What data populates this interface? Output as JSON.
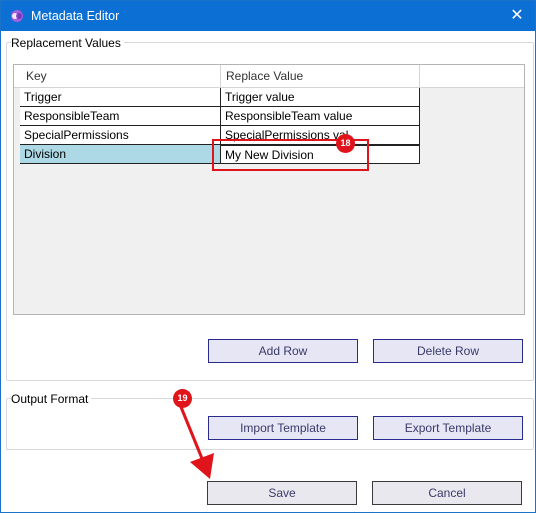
{
  "window": {
    "title": "Metadata Editor",
    "close_glyph": "✕",
    "accent_color": "#0b6fd4"
  },
  "replacement_values": {
    "group_label": "Replacement Values",
    "columns": [
      "Key",
      "Replace Value"
    ],
    "rows": [
      {
        "key": "Trigger",
        "value": "Trigger value"
      },
      {
        "key": "ResponsibleTeam",
        "value": "ResponsibleTeam value"
      },
      {
        "key": "SpecialPermissions",
        "value": "SpecialPermissions val"
      },
      {
        "key": "Division",
        "value": "My New Division"
      }
    ],
    "add_row_label": "Add Row",
    "delete_row_label": "Delete Row"
  },
  "output_format": {
    "group_label": "Output Format",
    "import_label": "Import Template",
    "export_label": "Export Template"
  },
  "footer": {
    "save_label": "Save",
    "cancel_label": "Cancel"
  },
  "annotations": {
    "step_18": "18",
    "step_19": "19",
    "highlight_color": "#e0151b"
  }
}
